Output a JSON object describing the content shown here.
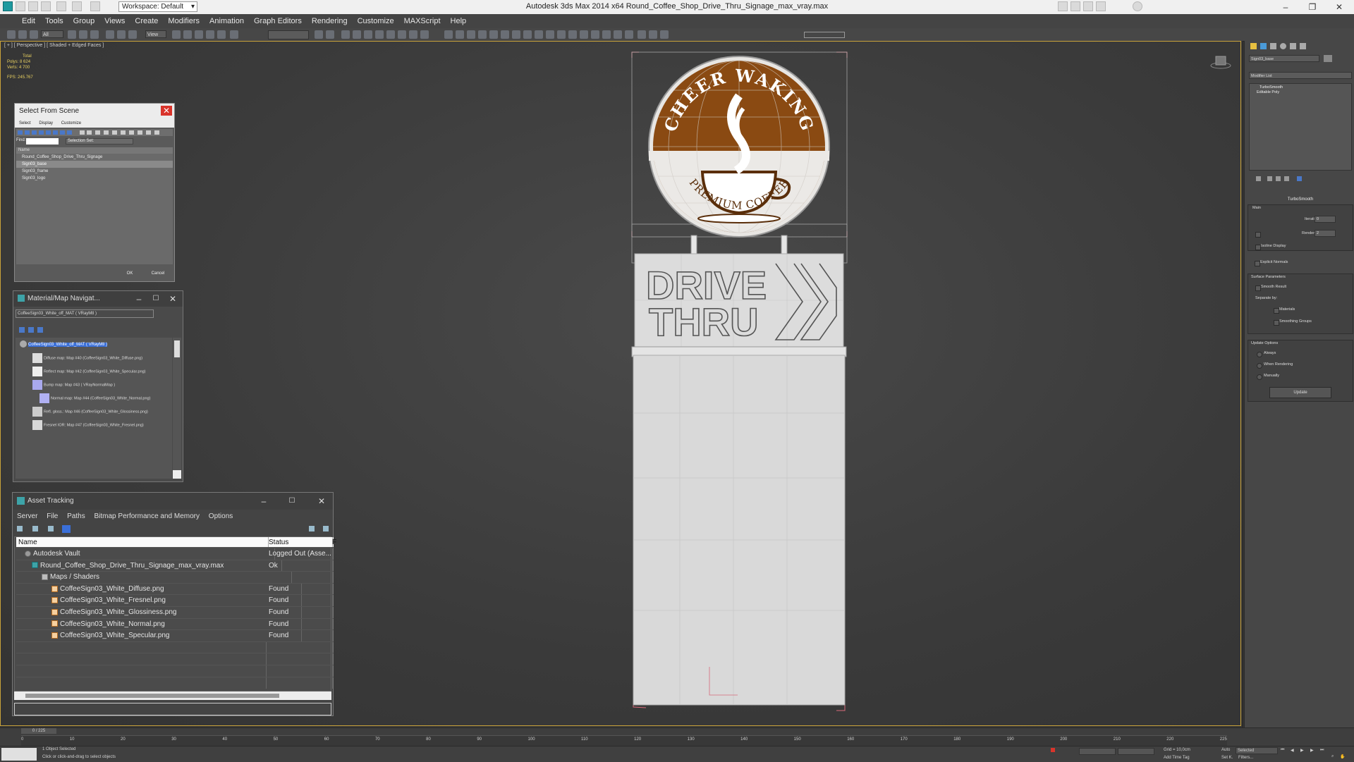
{
  "app": {
    "title": "Autodesk 3ds Max  2014 x64      Round_Coffee_Shop_Drive_Thru_Signage_max_vray.max",
    "workspace": "Workspace: Default"
  },
  "menu": [
    "Edit",
    "Tools",
    "Group",
    "Views",
    "Create",
    "Modifiers",
    "Animation",
    "Graph Editors",
    "Rendering",
    "Customize",
    "MAXScript",
    "Help"
  ],
  "toolbar": {
    "selection_filter": "All",
    "view_dropdown": "View"
  },
  "viewport": {
    "label": "[ + ] [ Perspective ] [ Shaded + Edged Faces ]",
    "stats_total": "Total",
    "stats_polys_label": "Polys:",
    "stats_polys": "8 624",
    "stats_verts_label": "Verts:",
    "stats_verts": "4 700",
    "fps_label": "FPS:",
    "fps": "245.767",
    "sign": {
      "arc_text": "CHEER WAKING",
      "bottom_text": "PREMIUM COFFEE",
      "drive_line1": "DRIVE",
      "drive_line2": "THRU"
    }
  },
  "select_from_scene": {
    "title": "Select From Scene",
    "menu": [
      "Select",
      "Display",
      "Customize"
    ],
    "find_label": "Find:",
    "selection_set": "Selection Set:",
    "col_name": "Name",
    "items": [
      "Round_Coffee_Shop_Drive_Thru_Signage",
      "Sign03_base",
      "Sign03_frame",
      "Sign03_logo"
    ],
    "ok": "OK",
    "cancel": "Cancel"
  },
  "material_navigator": {
    "title": "Material/Map Navigat...",
    "field": "CoffeeSign03_White_off_MAT  ( VRayMtl )",
    "tree": [
      "CoffeeSign03_White_off_MAT  ( VRayMtl )",
      "Diffuse map: Map #40 (CoffeeSign03_White_Diffuse.png)",
      "Reflect map: Map #42 (CoffeeSign03_White_Specular.png)",
      "Bump map: Map #43  ( VRayNormalMap )",
      "Normal map: Map #44 (CoffeeSign03_White_Normal.png)",
      "Refl. gloss.: Map #46 (CoffeeSign03_White_Glossiness.png)",
      "Fresnel IOR: Map #47 (CoffeeSign03_White_Fresnel.png)"
    ]
  },
  "asset_tracking": {
    "title": "Asset Tracking",
    "menu": [
      "Server",
      "File",
      "Paths",
      "Bitmap Performance and Memory",
      "Options"
    ],
    "col_name": "Name",
    "col_status": "Status",
    "col_extra": "F",
    "rows": [
      {
        "name": "Autodesk Vault",
        "status": "Logged Out (Asse..."
      },
      {
        "name": "Round_Coffee_Shop_Drive_Thru_Signage_max_vray.max",
        "status": "Ok"
      },
      {
        "name": "Maps / Shaders",
        "status": ""
      },
      {
        "name": "CoffeeSign03_White_Diffuse.png",
        "status": "Found"
      },
      {
        "name": "CoffeeSign03_White_Fresnel.png",
        "status": "Found"
      },
      {
        "name": "CoffeeSign03_White_Glossiness.png",
        "status": "Found"
      },
      {
        "name": "CoffeeSign03_White_Normal.png",
        "status": "Found"
      },
      {
        "name": "CoffeeSign03_White_Specular.png",
        "status": "Found"
      }
    ]
  },
  "command_panel": {
    "object_name": "Sign03_base",
    "modifier_list": "Modifier List",
    "stack": [
      "TurboSmooth",
      "Editable Poly"
    ],
    "turbosmooth": {
      "title": "TurboSmooth",
      "main": "Main",
      "iterations_label": "Iterations:",
      "iterations": "0",
      "render_iters_label": "Render Iters:",
      "render_iters": "2",
      "isoline": "Isoline Display",
      "explicit_normals": "Explicit Normals"
    },
    "surface": {
      "title": "Surface Parameters",
      "smooth_result": "Smooth Result",
      "separate_by": "Separate by:",
      "materials": "Materials",
      "smoothing_groups": "Smoothing Groups"
    },
    "update": {
      "title": "Update Options",
      "always": "Always",
      "when_rendering": "When Rendering",
      "manually": "Manually",
      "update_btn": "Update"
    }
  },
  "timeline": {
    "frame": "0 / 225",
    "ticks": [
      "0",
      "10",
      "20",
      "30",
      "40",
      "50",
      "60",
      "70",
      "80",
      "90",
      "100",
      "110",
      "120",
      "130",
      "140",
      "150",
      "160",
      "170",
      "180",
      "190",
      "200",
      "210",
      "220",
      "225"
    ]
  },
  "status": {
    "selected": "1 Object Selected",
    "prompt": "Click or click-and-drag to select objects",
    "grid": "Grid = 10,0cm",
    "auto": "Auto",
    "selected_dd": "Selected",
    "set_key": "Set K.",
    "filters": "Filters...",
    "add_time_tag": "Add Time Tag"
  },
  "colors": {
    "accent": "#3a6fd8",
    "coffee": "#8a4a12",
    "found": "#e4e4e4"
  }
}
